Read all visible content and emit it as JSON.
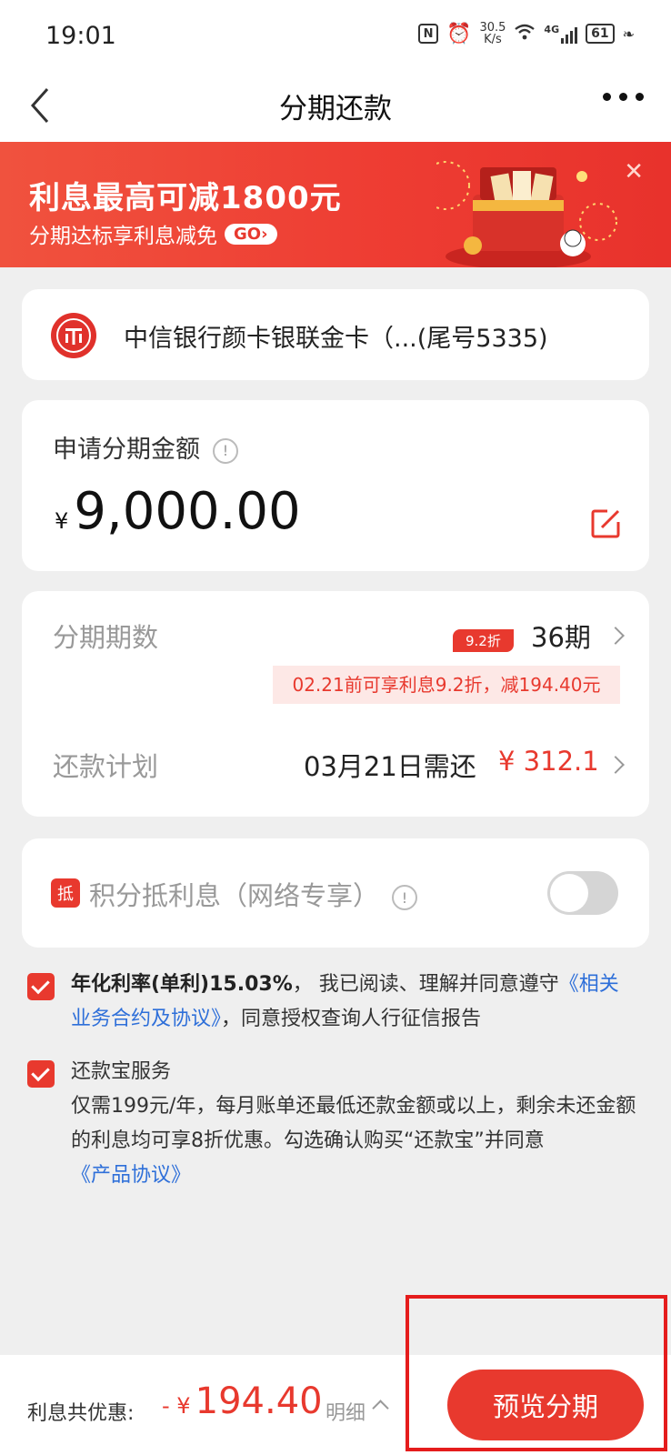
{
  "status_bar": {
    "time": "19:01",
    "net_speed_value": "30.5",
    "net_speed_unit": "K/s",
    "signal": "4G",
    "battery": "61"
  },
  "nav": {
    "title": "分期还款",
    "back_icon": "chevron-left-icon",
    "more_icon": "more-horizontal-icon"
  },
  "banner": {
    "title": "利息最高可减1800元",
    "subtitle": "分期达标享利息减免",
    "go_label": "GO›",
    "close_label": "✕"
  },
  "card": {
    "bank_name": "中信银行颜卡银联金卡（...(尾号5335)"
  },
  "amount": {
    "label": "申请分期金额",
    "info_label": "!",
    "currency": "¥",
    "value": "9,000.00"
  },
  "installment": {
    "periods_label": "分期期数",
    "discount_tag": "9.2折",
    "periods_value": "36期",
    "promo_text": "02.21前可享利息9.2折，减194.40元",
    "plan_label": "还款计划",
    "plan_date": "03月21日需还",
    "plan_amount": "¥ 312.1"
  },
  "points": {
    "badge": "抵",
    "label": "积分抵利息（网络专享）",
    "info_label": "!",
    "toggle_on": false
  },
  "agreements": [
    {
      "checked": true,
      "rate": "年化利率(单利)15.03%",
      "text1": "， 我已阅读、理解并同意遵守",
      "link": "《相关业务合约及协议》",
      "text2": "，同意授权查询人行征信报告"
    },
    {
      "checked": true,
      "title": "还款宝服务",
      "text": "仅需199元/年，每月账单还最低还款金额或以上，剩余未还金额的利息均可享8折优惠。勾选确认购买“还款宝”并同意",
      "link": "《产品协议》"
    }
  ],
  "footer": {
    "savings_label": "利息共优惠:",
    "savings_prefix": "- ¥",
    "savings_amount": "194.40",
    "detail_label": "明细",
    "cta_label": "预览分期"
  },
  "colors": {
    "accent": "#e8392e",
    "link": "#2e6fd9",
    "background": "#efefef"
  }
}
